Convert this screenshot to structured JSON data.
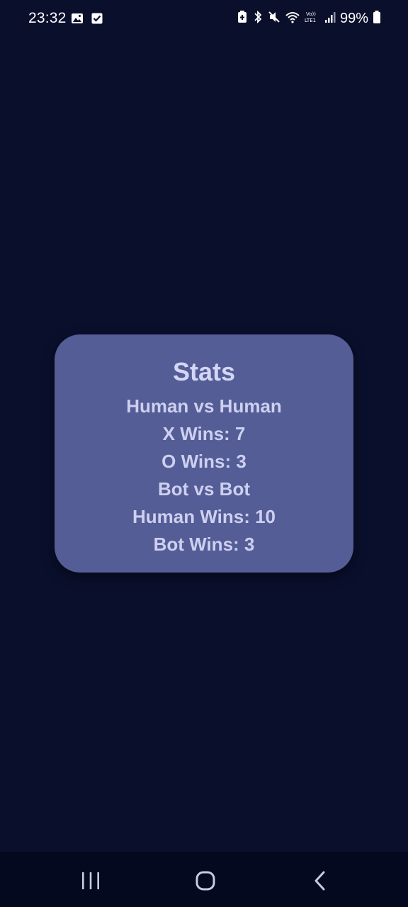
{
  "status_bar": {
    "time": "23:32",
    "battery": "99%",
    "left_icons": [
      "image-icon",
      "check-square-icon"
    ],
    "right_icons": [
      "battery-saver-icon",
      "bluetooth-icon",
      "mute-icon",
      "wifi-icon",
      "volte-lte-icon",
      "signal-icon",
      "battery-icon"
    ]
  },
  "stats": {
    "title": "Stats",
    "lines": [
      "Human vs Human",
      "X Wins: 7",
      "O Wins: 3",
      "Bot vs Bot",
      "Human Wins: 10",
      "Bot Wins: 3"
    ]
  },
  "nav": {
    "buttons": [
      "recent-apps-icon",
      "home-icon",
      "back-icon"
    ]
  },
  "colors": {
    "background": "#0a0f2c",
    "card": "#545d96",
    "card_text": "#cdd0ef",
    "nav_bar": "#050920"
  }
}
